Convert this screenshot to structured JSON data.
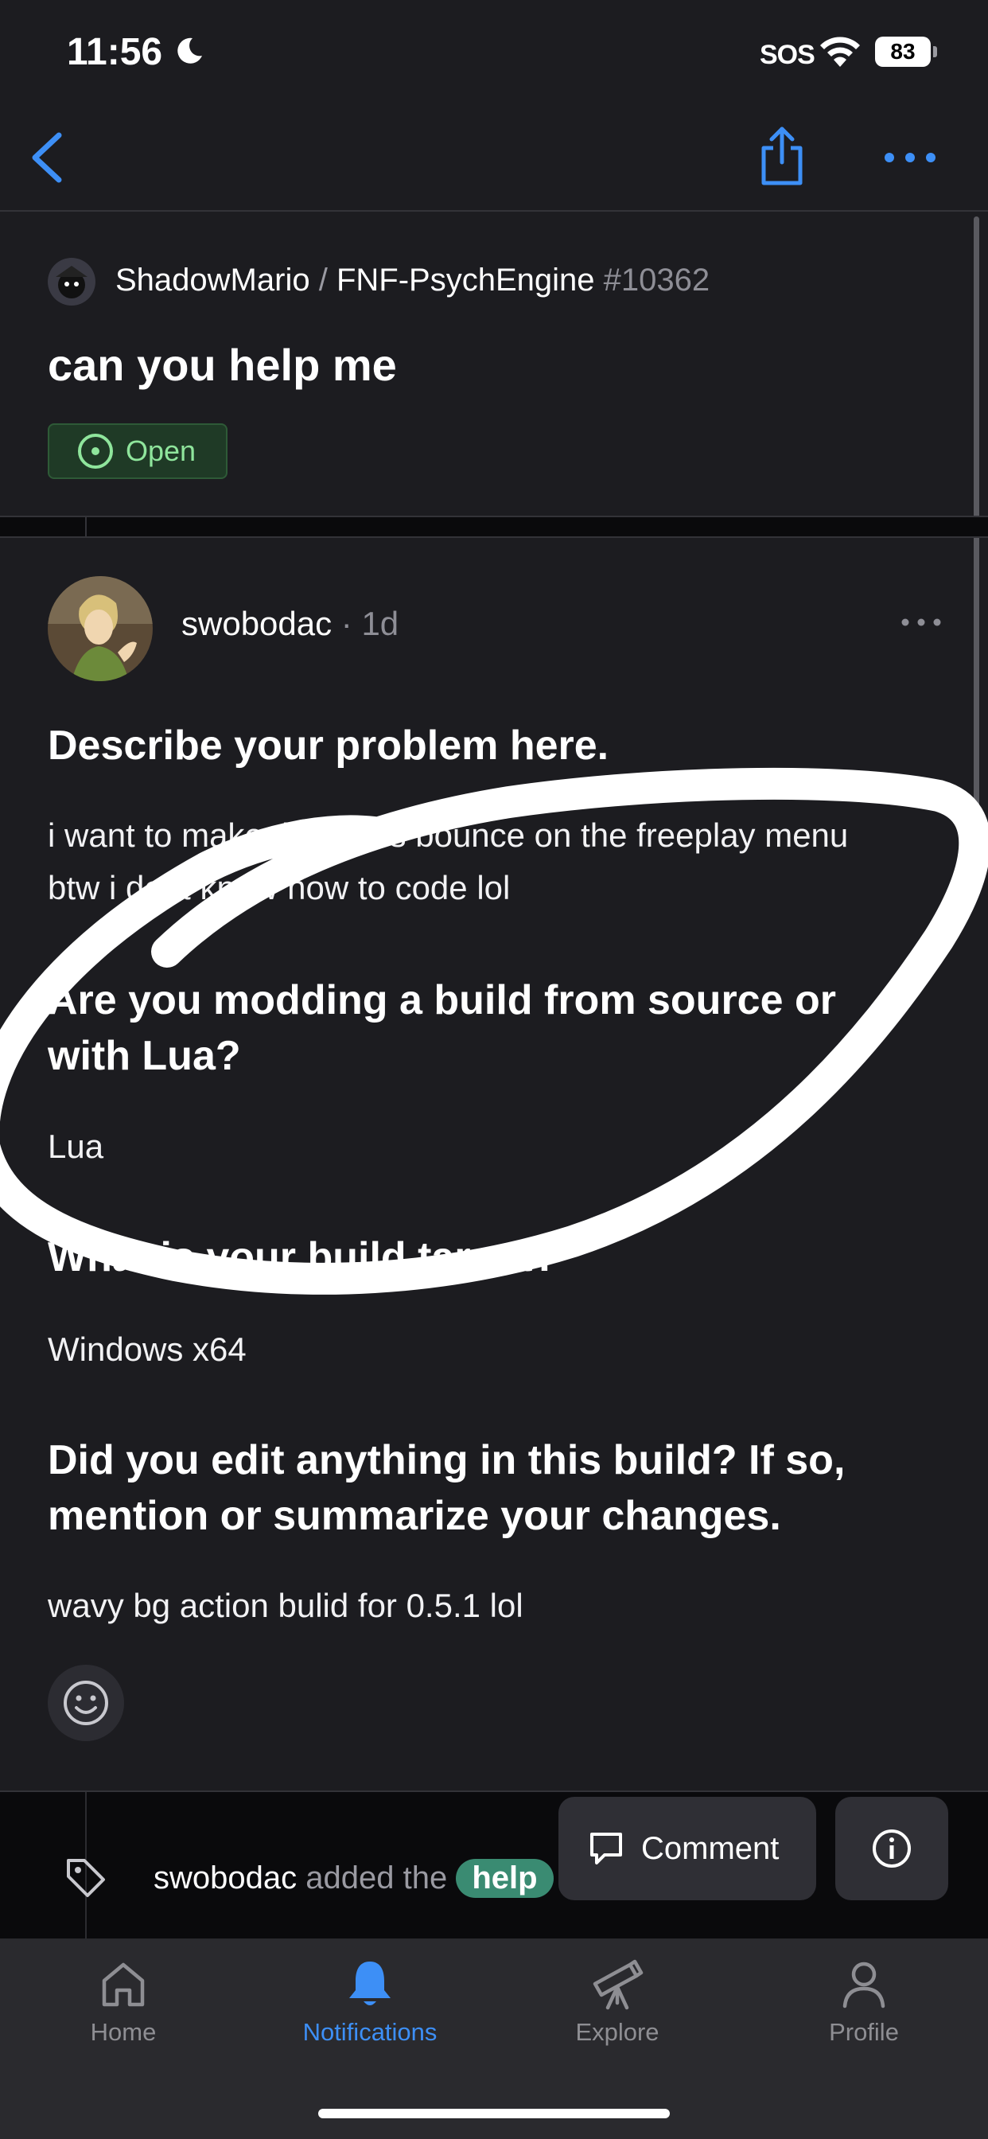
{
  "status_bar": {
    "time": "11:56",
    "sos": "SOS",
    "battery": "83"
  },
  "issue": {
    "owner": "ShadowMario",
    "separator": "/",
    "repo": "FNF-PsychEngine",
    "number": "#10362",
    "title": "can you help me",
    "state": "Open"
  },
  "comment": {
    "author": "swobodac",
    "age": "· 1d",
    "sections": [
      {
        "heading": "Describe your problem here.",
        "body_line1": "i want to make the icons bounce on the freeplay menu",
        "body_line2": "btw i dont know how to code lol"
      },
      {
        "heading_line1": "Are you modding a build from source or",
        "heading_line2": "with Lua?",
        "body": "Lua"
      },
      {
        "heading": "What is your build target?",
        "body": "Windows x64"
      },
      {
        "heading_line1": "Did you edit anything in this build? If so,",
        "heading_line2": "mention or summarize your changes.",
        "body": "wavy bg action bulid for 0.5.1 lol"
      }
    ]
  },
  "event": {
    "actor": "swobodac",
    "action": "added the",
    "label": "help"
  },
  "actions": {
    "comment_label": "Comment"
  },
  "tabs": [
    {
      "label": "Home",
      "icon": "home-icon"
    },
    {
      "label": "Notifications",
      "icon": "bell-icon"
    },
    {
      "label": "Explore",
      "icon": "telescope-icon"
    },
    {
      "label": "Profile",
      "icon": "person-icon"
    }
  ],
  "colors": {
    "accent": "#3d8ff6",
    "open_green": "#8fe59c",
    "label_green": "#3a8b72"
  }
}
